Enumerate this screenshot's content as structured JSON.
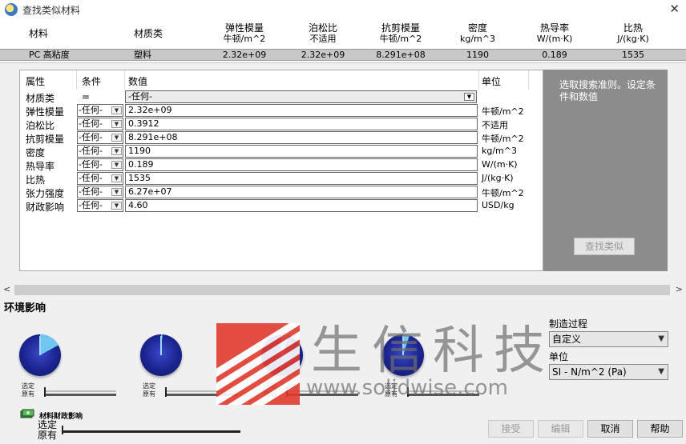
{
  "window": {
    "title": "查找类似材料",
    "close": "✕"
  },
  "results": {
    "headers": [
      {
        "line1": "材料",
        "line2": ""
      },
      {
        "line1": "材质类",
        "line2": ""
      },
      {
        "line1": "弹性模量",
        "line2": "牛顿/m^2"
      },
      {
        "line1": "泊松比",
        "line2": "不适用"
      },
      {
        "line1": "抗剪模量",
        "line2": "牛顿/m^2"
      },
      {
        "line1": "密度",
        "line2": "kg/m^3"
      },
      {
        "line1": "热导率",
        "line2": "W/(m·K)"
      },
      {
        "line1": "比热",
        "line2": "J/(kg·K)"
      }
    ],
    "row": [
      "PC 高粘度",
      "塑料",
      "2.32e+09",
      "2.32e+09",
      "8.291e+08",
      "1190",
      "0.189",
      "1535"
    ]
  },
  "criteria": {
    "headers": {
      "property": "属性",
      "condition": "条件",
      "value": "数值",
      "unit": "单位"
    },
    "material_class": {
      "name": "材质类",
      "op": "=",
      "value": "-任何-"
    },
    "any_label": "-任何-",
    "rows": [
      {
        "name": "弹性模量",
        "value": "2.32e+09",
        "unit": "牛顿/m^2"
      },
      {
        "name": "泊松比",
        "value": "0.3912",
        "unit": "不适用"
      },
      {
        "name": "抗剪模量",
        "value": "8.291e+08",
        "unit": "牛顿/m^2"
      },
      {
        "name": "密度",
        "value": "1190",
        "unit": "kg/m^3"
      },
      {
        "name": "热导率",
        "value": "0.189",
        "unit": "W/(m·K)"
      },
      {
        "name": "比热",
        "value": "1535",
        "unit": "J/(kg·K)"
      },
      {
        "name": "张力强度",
        "value": "6.27e+07",
        "unit": "牛顿/m^2"
      },
      {
        "name": "财政影响",
        "value": "4.60",
        "unit": "USD/kg"
      }
    ]
  },
  "tip": {
    "text": "选取搜索准则。设定条件和数值",
    "find_button": "查找类似"
  },
  "scroll": {
    "left": "<",
    "right": ">"
  },
  "environment": {
    "title": "环境影响",
    "selected_label": "选定",
    "original_label": "原有",
    "gauges": [
      {
        "fill_fraction": 0.17
      },
      {
        "fill_fraction": 0.01
      },
      {
        "fill_fraction": 0.05
      },
      {
        "fill_fraction": 0.05
      }
    ],
    "financial": {
      "label": "材料财政影响",
      "selected": "选定",
      "original": "原有"
    }
  },
  "right_panel": {
    "process_label": "制造过程",
    "process_value": "自定义",
    "unit_label": "单位",
    "unit_value": "SI - N/m^2 (Pa)"
  },
  "buttons": {
    "accept": "接受",
    "edit": "编辑",
    "cancel": "取消",
    "help": "帮助"
  },
  "watermark": {
    "cn": "生信科技",
    "en": "www.solidwise.com"
  },
  "colors": {
    "gauge_fill": "#6fc7f0",
    "gauge_body": "#1a2490",
    "tip_panel": "#8c8c8c",
    "selected_row": "#c8c8c8",
    "watermark_red": "#e23b2e"
  }
}
